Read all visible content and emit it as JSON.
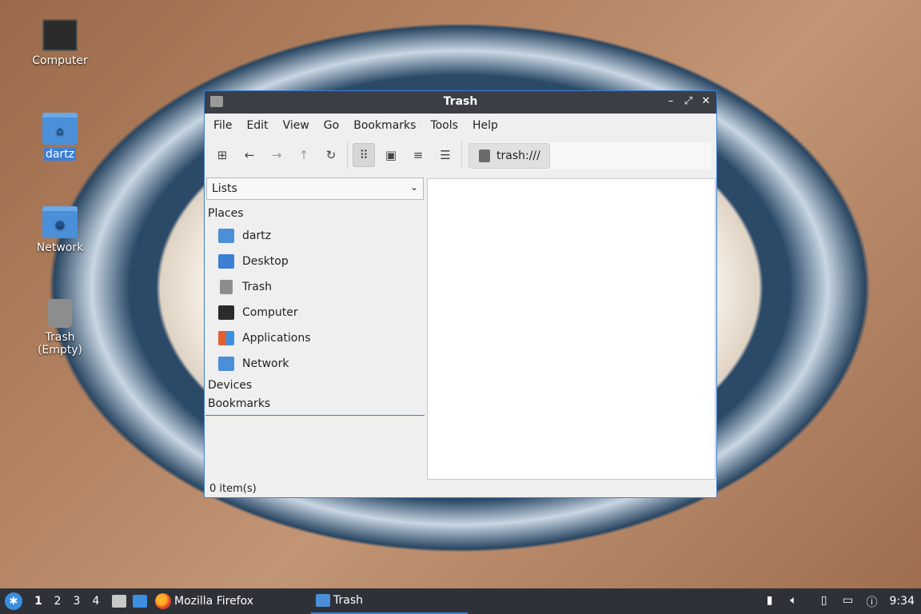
{
  "desktop": {
    "icons": [
      {
        "label": "Computer",
        "icon": "computer-icon"
      },
      {
        "label": "dartz",
        "icon": "home-folder-icon"
      },
      {
        "label": "Network",
        "icon": "network-folder-icon"
      },
      {
        "label": "Trash (Empty)",
        "icon": "trash-icon"
      }
    ]
  },
  "window": {
    "title": "Trash",
    "menu": [
      "File",
      "Edit",
      "View",
      "Go",
      "Bookmarks",
      "Tools",
      "Help"
    ],
    "toolbar": {
      "new_tab": "⊞",
      "back": "←",
      "forward": "→",
      "up": "↑",
      "reload": "↻",
      "icon_view": "⠿",
      "thumbnail_view": "▣",
      "compact_view": "≡",
      "detailed_view": "☰"
    },
    "path": "trash:///",
    "sidebar": {
      "mode": "Lists",
      "places_header": "Places",
      "places": [
        {
          "label": "dartz",
          "icon": "home-folder-icon",
          "color": "#4a8fd8"
        },
        {
          "label": "Desktop",
          "icon": "desktop-icon",
          "color": "#3c7fd4"
        },
        {
          "label": "Trash",
          "icon": "trash-icon",
          "color": "#8d8d8d"
        },
        {
          "label": "Computer",
          "icon": "computer-icon",
          "color": "#2b2b2b"
        },
        {
          "label": "Applications",
          "icon": "applications-icon",
          "color": "#e06030"
        },
        {
          "label": "Network",
          "icon": "network-folder-icon",
          "color": "#4a8fd8"
        }
      ],
      "devices_header": "Devices",
      "bookmarks_header": "Bookmarks"
    },
    "status": "0 item(s)"
  },
  "taskbar": {
    "workspaces": [
      "1",
      "2",
      "3",
      "4"
    ],
    "tasks": [
      {
        "label": "Mozilla Firefox"
      },
      {
        "label": "Trash"
      }
    ],
    "clock": "9:34"
  }
}
